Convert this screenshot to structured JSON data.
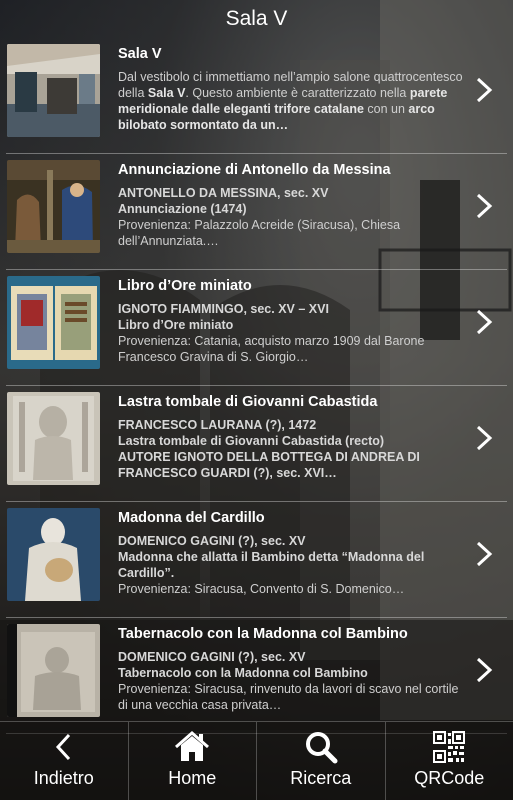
{
  "header": {
    "title": "Sala V"
  },
  "items": [
    {
      "title": "Sala V",
      "desc_html": "Dal vestibolo ci immettiamo nell’ampio salone quattrocentesco della <b>Sala V</b>. Questo ambiente è caratterizzato nella <b>parete meridionale dalle eleganti trifore catalane</b> con un <b>arco bilobato sormontato da un…</b>"
    },
    {
      "title": "Annunciazione di Antonello da Messina",
      "line1": "ANTONELLO DA MESSINA, sec. XV",
      "line2": "Annunciazione (1474)",
      "line3": "Provenienza: Palazzolo Acreide (Siracusa), Chiesa dell’Annunziata.…"
    },
    {
      "title": "Libro d’Ore miniato",
      "line1": "IGNOTO FIAMMINGO, sec. XV – XVI",
      "line2": "Libro d’Ore miniato",
      "line3": "Provenienza: Catania, acquisto marzo 1909 dal Barone Francesco Gravina di S. Giorgio…"
    },
    {
      "title": "Lastra tombale di Giovanni Cabastida",
      "line1": "FRANCESCO LAURANA (?), 1472",
      "line2": "Lastra tombale di Giovanni Cabastida (recto)",
      "line3": "AUTORE IGNOTO DELLA BOTTEGA DI ANDREA DI FRANCESCO GUARDI (?), sec. XVI…"
    },
    {
      "title": "Madonna del Cardillo",
      "line1": "DOMENICO GAGINI (?), sec. XV",
      "line2": "Madonna che allatta il Bambino detta “Madonna del Cardillo”.",
      "line3": "Provenienza: Siracusa, Convento di S. Domenico…"
    },
    {
      "title": "Tabernacolo con la Madonna col Bambino",
      "line1": "DOMENICO GAGINI (?), sec. XV",
      "line2": "Tabernacolo con la Madonna col Bambino",
      "line3": "Provenienza: Siracusa, rinvenuto da lavori di scavo nel cortile di una vecchia casa privata…"
    }
  ],
  "tabs": [
    {
      "label": "Indietro",
      "icon": "chevron-left-icon"
    },
    {
      "label": "Home",
      "icon": "home-icon"
    },
    {
      "label": "Ricerca",
      "icon": "search-icon"
    },
    {
      "label": "QRCode",
      "icon": "qrcode-icon"
    }
  ]
}
